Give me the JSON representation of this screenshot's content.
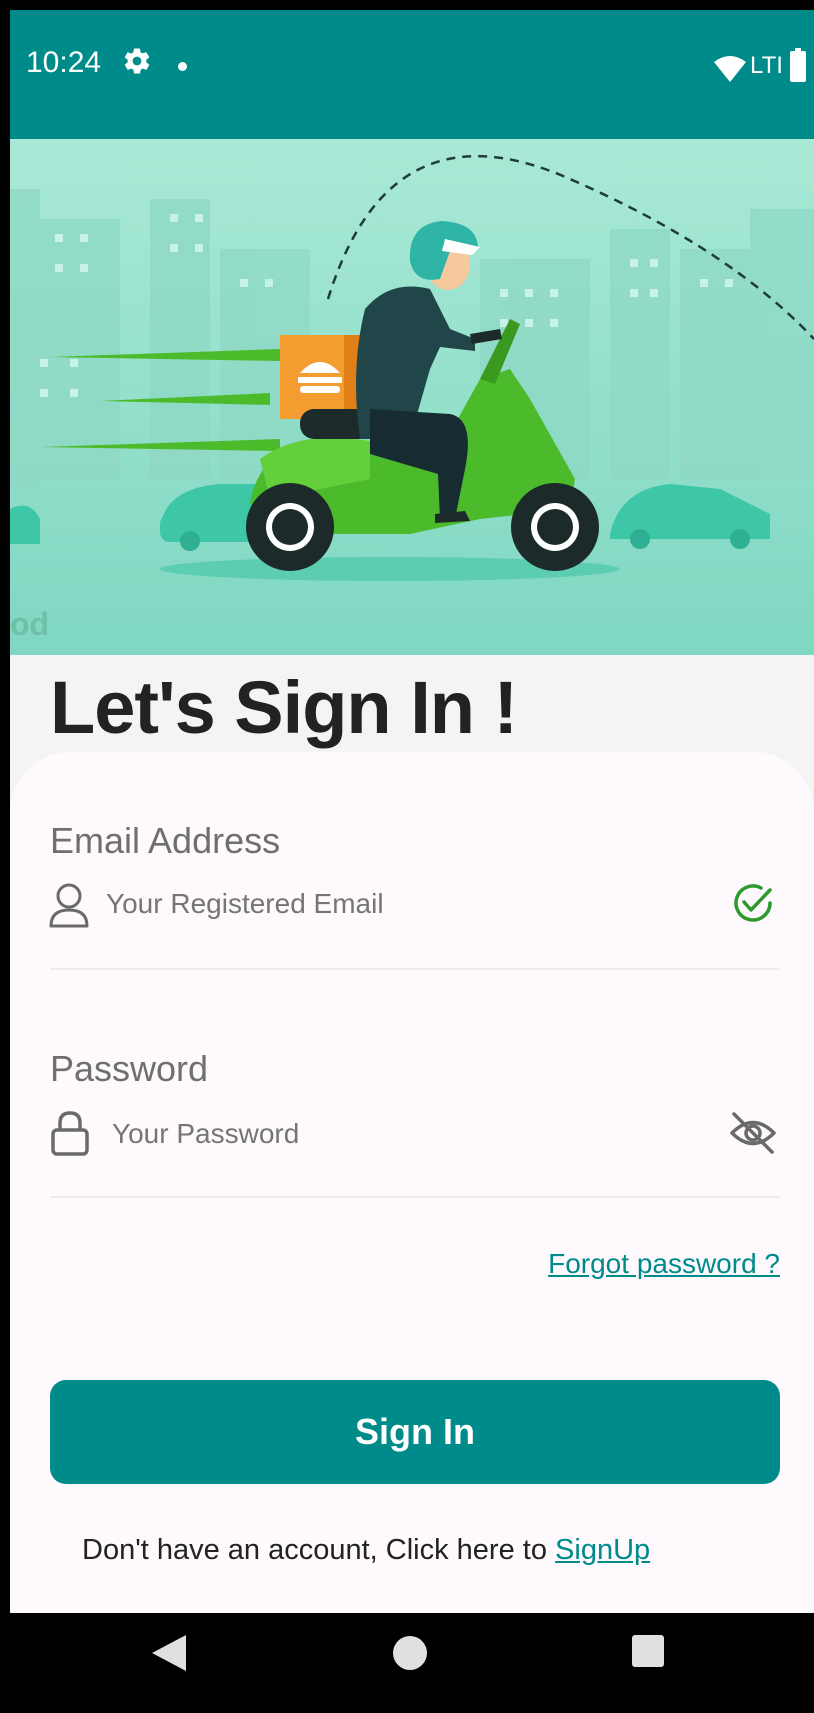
{
  "status_bar": {
    "time": "10:24",
    "network": "LTE",
    "icons": [
      "gear-icon",
      "notification-dot-icon",
      "wifi-icon",
      "battery-icon"
    ]
  },
  "hero": {
    "watermark": "od"
  },
  "page_title": "Let's Sign In !",
  "email": {
    "label": "Email Address",
    "placeholder": "Your Registered Email",
    "value": "",
    "icon": "user-icon",
    "status_icon": "check-circle-icon"
  },
  "password": {
    "label": "Password",
    "placeholder": "Your Password",
    "value": "",
    "icon": "lock-icon",
    "toggle_icon": "eye-off-icon"
  },
  "forgot_password": "Forgot password ?",
  "signin_button": "Sign In",
  "signup": {
    "prompt": "Don't have an account, Click here to ",
    "link": "SignUp"
  },
  "colors": {
    "primary": "#008b8b",
    "success": "#2e9a2e",
    "title": "#222222",
    "card": "#fdf9fd"
  },
  "nav_bar": {
    "icons": [
      "back-icon",
      "home-icon",
      "recents-icon"
    ]
  }
}
